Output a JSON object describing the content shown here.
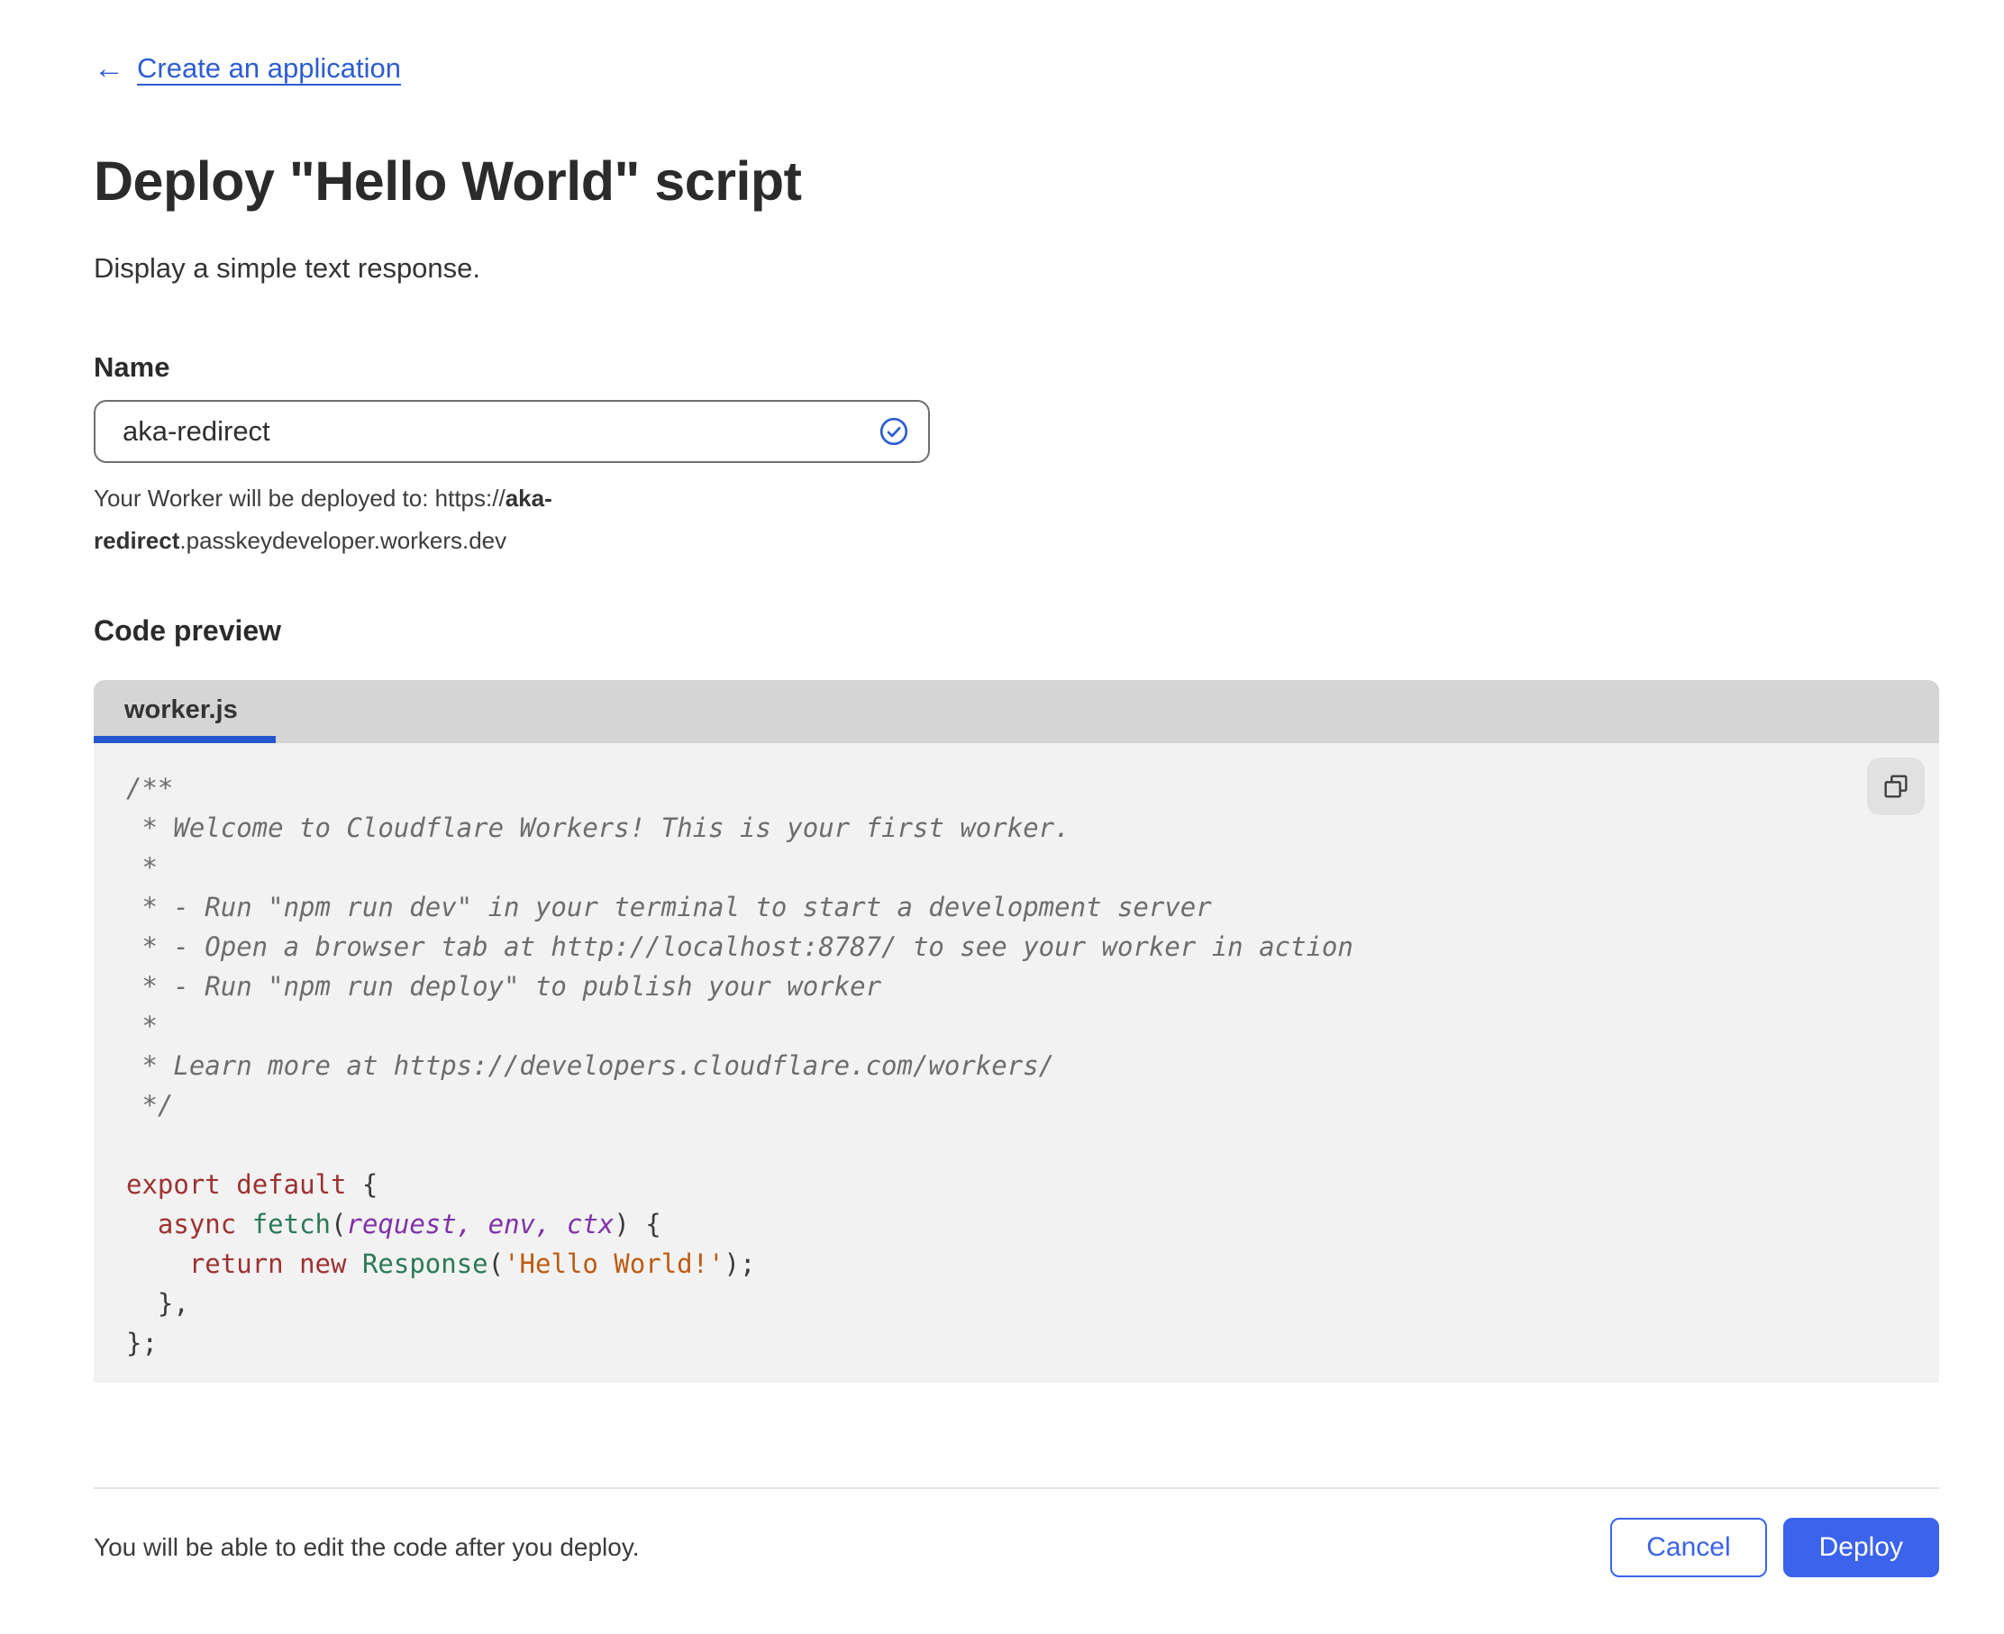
{
  "page": {
    "back_link_label": "Create an application",
    "back_arrow": "←",
    "title": "Deploy \"Hello World\" script",
    "subtitle": "Display a simple text response."
  },
  "name_field": {
    "label": "Name",
    "value": "aka-redirect",
    "helper_prefix": "Your Worker will be deployed to: https://",
    "helper_bold": "aka-redirect",
    "helper_suffix": ".passkeydeveloper.workers.dev",
    "validation_state": "valid"
  },
  "code_preview": {
    "section_label": "Code preview",
    "tab_label": "worker.js",
    "copy_icon": "copy-icon",
    "lines": [
      [
        {
          "t": "/**",
          "c": "cm"
        }
      ],
      [
        {
          "t": " * Welcome to Cloudflare Workers! This is your first worker.",
          "c": "cm"
        }
      ],
      [
        {
          "t": " *",
          "c": "cm"
        }
      ],
      [
        {
          "t": " * - Run \"npm run dev\" in your terminal to start a development server",
          "c": "cm"
        }
      ],
      [
        {
          "t": " * - Open a browser tab at http://localhost:8787/ to see your worker in action",
          "c": "cm"
        }
      ],
      [
        {
          "t": " * - Run \"npm run deploy\" to publish your worker",
          "c": "cm"
        }
      ],
      [
        {
          "t": " *",
          "c": "cm"
        }
      ],
      [
        {
          "t": " * Learn more at https://developers.cloudflare.com/workers/",
          "c": "cm"
        }
      ],
      [
        {
          "t": " */",
          "c": "cm"
        }
      ],
      [],
      [
        {
          "t": "export",
          "c": "kw"
        },
        {
          "t": " ",
          "c": "pl"
        },
        {
          "t": "default",
          "c": "kw"
        },
        {
          "t": " {",
          "c": "pl"
        }
      ],
      [
        {
          "t": "  ",
          "c": "pl"
        },
        {
          "t": "async",
          "c": "kw"
        },
        {
          "t": " ",
          "c": "pl"
        },
        {
          "t": "fetch",
          "c": "fn"
        },
        {
          "t": "(",
          "c": "pl"
        },
        {
          "t": "request",
          "c": "vr"
        },
        {
          "t": ",",
          "c": "vr"
        },
        {
          "t": " ",
          "c": "pl"
        },
        {
          "t": "env",
          "c": "vr"
        },
        {
          "t": ",",
          "c": "vr"
        },
        {
          "t": " ",
          "c": "pl"
        },
        {
          "t": "ctx",
          "c": "vr"
        },
        {
          "t": ")",
          "c": "pl"
        },
        {
          "t": " {",
          "c": "pl"
        }
      ],
      [
        {
          "t": "    ",
          "c": "pl"
        },
        {
          "t": "return",
          "c": "kw"
        },
        {
          "t": " ",
          "c": "pl"
        },
        {
          "t": "new",
          "c": "kw"
        },
        {
          "t": " ",
          "c": "pl"
        },
        {
          "t": "Response",
          "c": "fn"
        },
        {
          "t": "(",
          "c": "pl"
        },
        {
          "t": "'Hello World!'",
          "c": "st"
        },
        {
          "t": ");",
          "c": "pl"
        }
      ],
      [
        {
          "t": "  },",
          "c": "pl"
        }
      ],
      [
        {
          "t": "};",
          "c": "pl"
        }
      ]
    ]
  },
  "footer": {
    "note": "You will be able to edit the code after you deploy.",
    "cancel_label": "Cancel",
    "deploy_label": "Deploy"
  },
  "colors": {
    "accent_link_blue": "#2d5dd2",
    "tab_indicator_blue": "#2456cf",
    "button_blue": "#3b63ec",
    "tab_bar_gray": "#d5d5d5",
    "code_background": "#f2f2f2",
    "syntax_keyword": "#9e3131",
    "syntax_function": "#2b7a57",
    "syntax_variable": "#8032a8",
    "syntax_string": "#bd5b12",
    "syntax_comment": "#6d6d6d"
  }
}
